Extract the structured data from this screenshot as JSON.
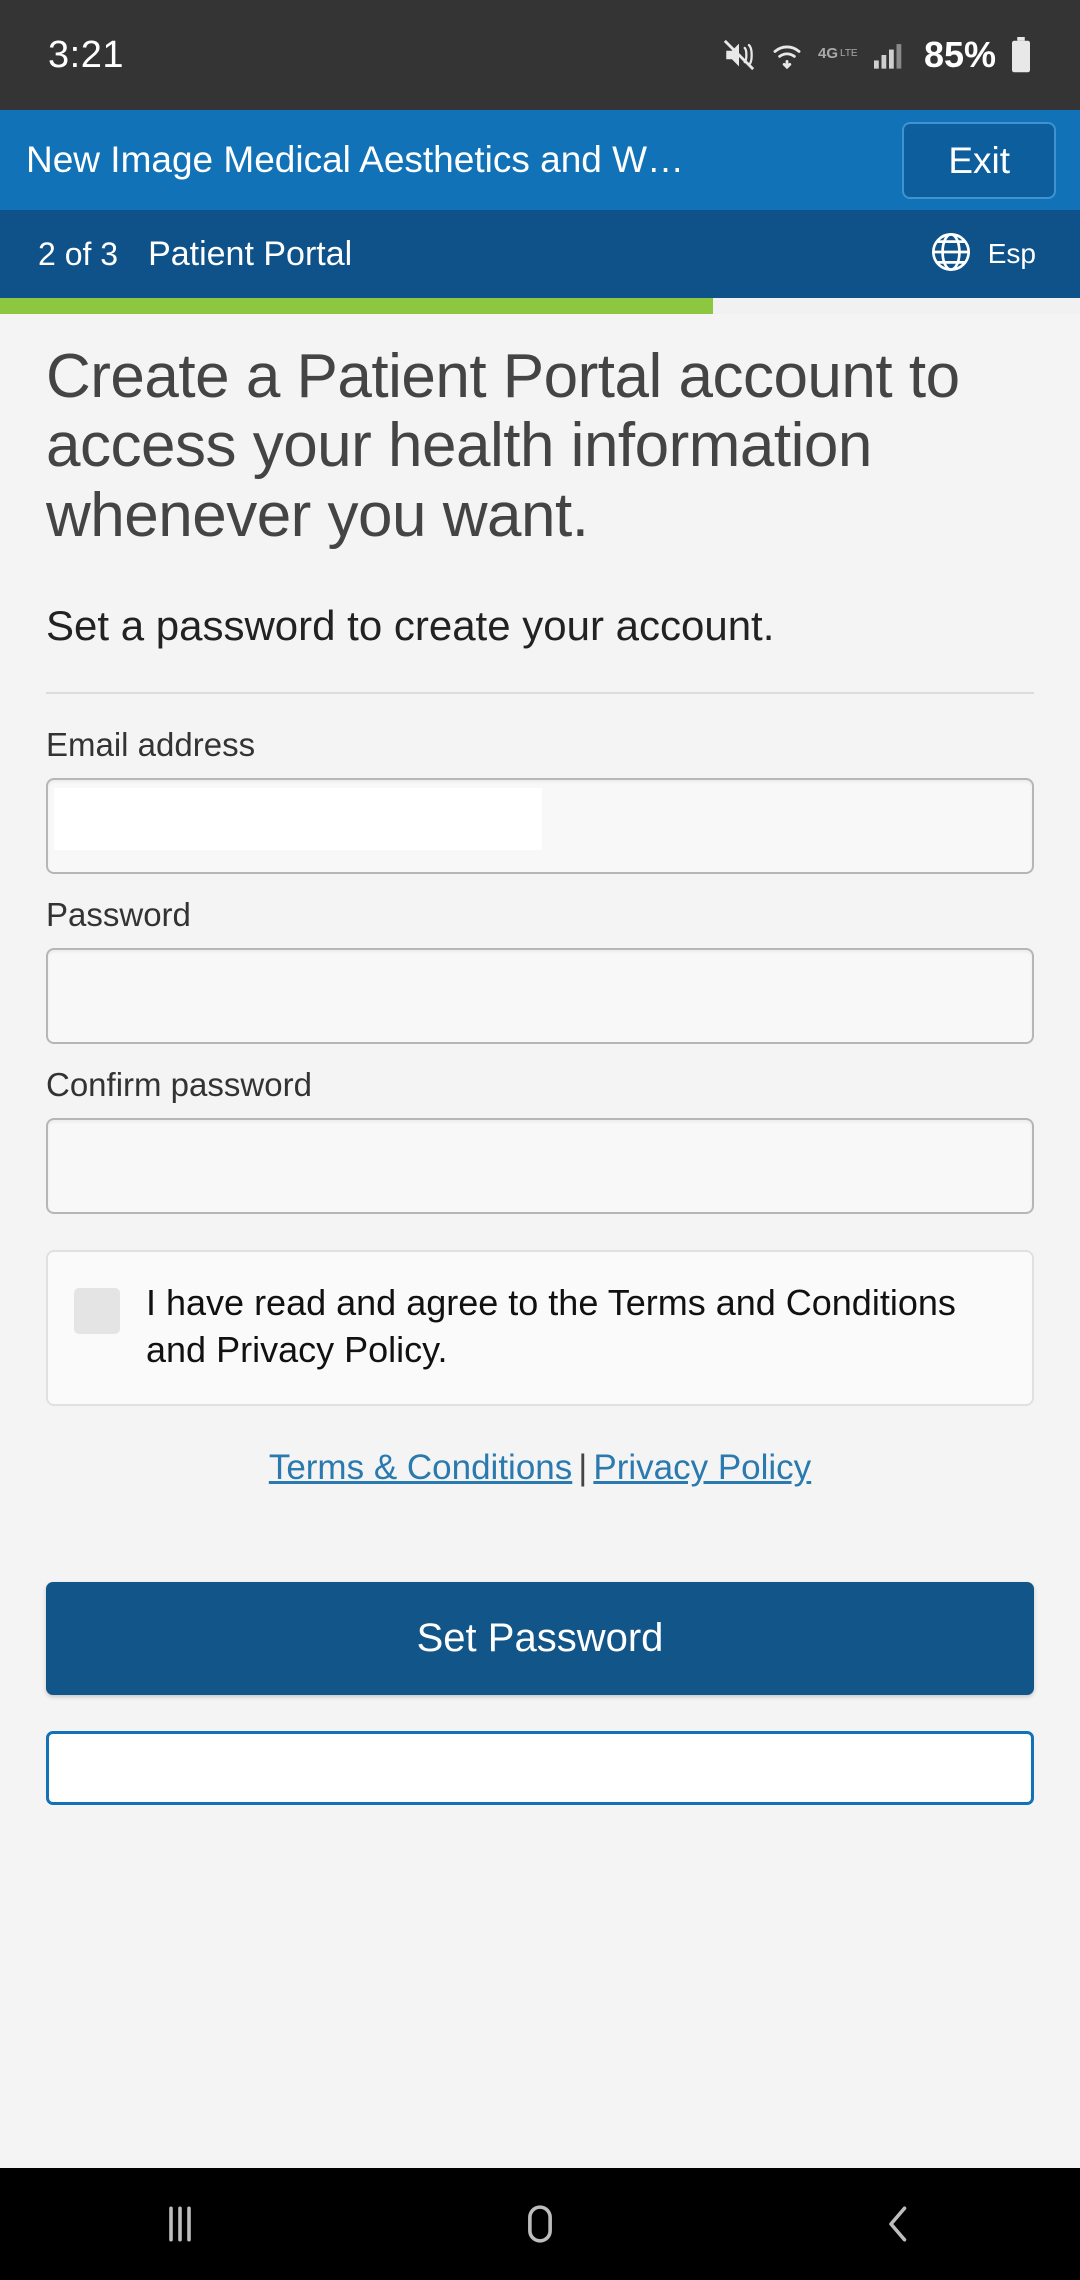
{
  "status_bar": {
    "time": "3:21",
    "battery_percent": "85%",
    "icons": [
      "mute-icon",
      "wifi-icon",
      "4g-lte-icon",
      "signal-bars-icon",
      "battery-icon"
    ]
  },
  "app_header": {
    "title": "New Image Medical Aesthetics and W…",
    "exit_label": "Exit",
    "background_color": "#1272b8"
  },
  "sub_header": {
    "step": "2 of 3",
    "section": "Patient Portal",
    "language_label": "Esp",
    "language_icon": "globe-icon",
    "background_color": "#0f5289"
  },
  "progress": {
    "percent": 66,
    "fill_color": "#8dc63f",
    "track_color": "#f1f1f1"
  },
  "main": {
    "headline": "Create a Patient Portal account to access your health information whenever you want.",
    "subhead": "Set a password to create your account.",
    "fields": [
      {
        "label": "Email address",
        "value": "",
        "placeholder": "",
        "redacted": true
      },
      {
        "label": "Password",
        "value": "",
        "placeholder": "",
        "redacted": false
      },
      {
        "label": "Confirm password",
        "value": "",
        "placeholder": "",
        "redacted": false
      }
    ],
    "consent": {
      "text": "I have read and agree to the Terms and Conditions and Privacy Policy.",
      "checked": false
    },
    "links": {
      "terms": "Terms & Conditions",
      "separator": "|",
      "privacy": "Privacy Policy",
      "color": "#2a7ab0"
    },
    "primary_button": "Set Password",
    "secondary_button": ""
  },
  "nav_bar": {
    "items": [
      "recents-icon",
      "home-icon",
      "back-icon"
    ]
  }
}
